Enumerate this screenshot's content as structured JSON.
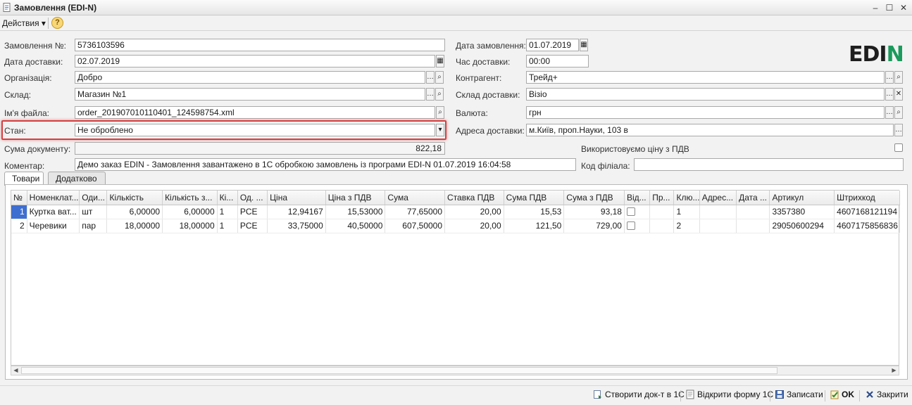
{
  "window": {
    "title": "Замовлення (EDI-N)"
  },
  "toolbar": {
    "actions_label": "Действия ▾",
    "help": "?"
  },
  "logo": {
    "text": "EDIN"
  },
  "form": {
    "order_no_label": "Замовлення №:",
    "order_no": "5736103596",
    "delivery_date_label": "Дата доставки:",
    "delivery_date": "02.07.2019",
    "org_label": "Організація:",
    "org": "Добро",
    "warehouse_label": "Склад:",
    "warehouse": "Магазин №1",
    "filename_label": "Ім'я файла:",
    "filename": "order_201907010110401_124598754.xml",
    "state_label": "Стан:",
    "state": "Не оброблено",
    "doc_sum_label": "Сума документу:",
    "doc_sum": "822,18",
    "comment_label": "Коментар:",
    "comment": "Демо заказ EDIN - Замовлення завантажено в 1С обробкою замовлень із програми EDI-N 01.07.2019 16:04:58",
    "order_date_label": "Дата замовлення:",
    "order_date": "01.07.2019",
    "delivery_time_label": "Час доставки:",
    "delivery_time": "00:00",
    "counterparty_label": "Контрагент:",
    "counterparty": "Трейд+",
    "delivery_wh_label": "Склад доставки:",
    "delivery_wh": "Візіо",
    "currency_label": "Валюта:",
    "currency": "грн",
    "delivery_addr_label": "Адреса доставки:",
    "delivery_addr": "м.Київ, проп.Науки, 103 в",
    "vat_price_label": "Використовуємо ціну з ПДВ",
    "branch_code_label": "Код філіала:",
    "branch_code": ""
  },
  "tabs": [
    {
      "label": "Товари"
    },
    {
      "label": "Додатково"
    }
  ],
  "table": {
    "columns": [
      "№",
      "Номенклат...",
      "Оди...",
      "Кількість",
      "Кількість з...",
      "Кі...",
      "Од. ...",
      "Ціна",
      "Ціна з ПДВ",
      "Сума",
      "Ставка ПДВ",
      "Сума ПДВ",
      "Сума з ПДВ",
      "Від...",
      "Пр...",
      "Клю...",
      "Адрес...",
      "Дата ...",
      "Артикул",
      "Штрихкод"
    ],
    "rows": [
      {
        "n": "1",
        "name": "Куртка ват...",
        "unit": "шт",
        "qty": "6,00000",
        "qty2": "6,00000",
        "k": "1",
        "od": "PCE",
        "price": "12,94167",
        "price_vat": "15,53000",
        "sum": "77,65000",
        "vat_rate": "20,00",
        "vat_sum": "15,53",
        "sum_vat": "93,18",
        "pr": "",
        "key": "1",
        "addr": "",
        "date": "",
        "article": "3357380",
        "barcode": "4607168121194"
      },
      {
        "n": "2",
        "name": "Черевики",
        "unit": "пар",
        "qty": "18,00000",
        "qty2": "18,00000",
        "k": "1",
        "od": "PCE",
        "price": "33,75000",
        "price_vat": "40,50000",
        "sum": "607,50000",
        "vat_rate": "20,00",
        "vat_sum": "121,50",
        "sum_vat": "729,00",
        "pr": "",
        "key": "2",
        "addr": "",
        "date": "",
        "article": "29050600294",
        "barcode": "4607175856836"
      }
    ]
  },
  "bottom": {
    "create_doc": "Створити док-т в 1С",
    "open_form": "Відкрити форму 1С",
    "save": "Записати",
    "ok": "OK",
    "close": "Закрити"
  },
  "colors": {
    "accent": "#3d6fd1",
    "highlight": "#d64040",
    "logo_green": "#1a9a5c"
  }
}
